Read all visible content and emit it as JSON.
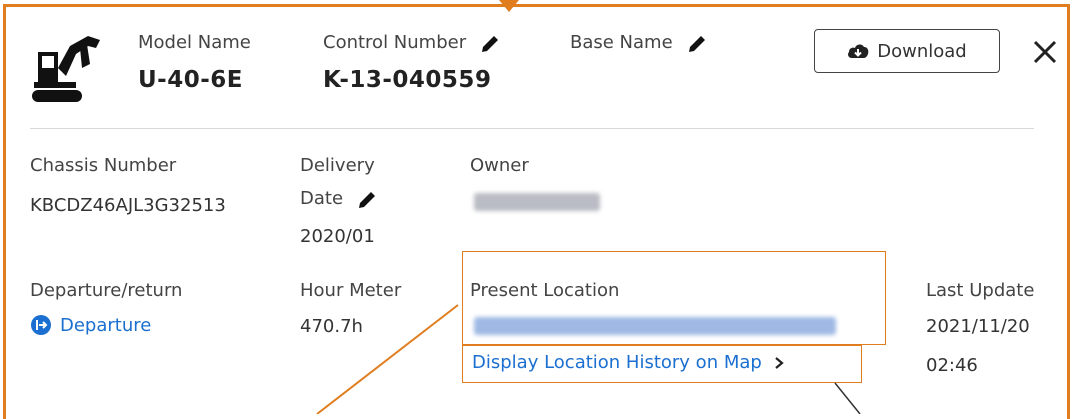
{
  "header": {
    "model_label": "Model Name",
    "model_value": "U-40-6E",
    "control_label": "Control Number",
    "control_value": "K-13-040559",
    "base_label": "Base Name",
    "download_label": "Download"
  },
  "details": {
    "chassis_label": "Chassis Number",
    "chassis_value": "KBCDZ46AJL3G32513",
    "delivery_label_line1": "Delivery",
    "delivery_label_line2": "Date",
    "delivery_value": "2020/01",
    "owner_label": "Owner",
    "departure_label": "Departure/return",
    "departure_value": "Departure",
    "hour_label": "Hour Meter",
    "hour_value": "470.7h",
    "location_label": "Present Location",
    "history_link": "Display Location History on Map",
    "update_label": "Last Update",
    "update_date": "2021/11/20",
    "update_time": "02:46"
  },
  "colors": {
    "accent_orange": "#e07d1f",
    "link_blue": "#1a6fd0"
  },
  "icons": [
    "excavator-icon",
    "pencil-icon",
    "cloud-download-icon",
    "close-icon",
    "departure-icon",
    "chevron-right-icon"
  ]
}
